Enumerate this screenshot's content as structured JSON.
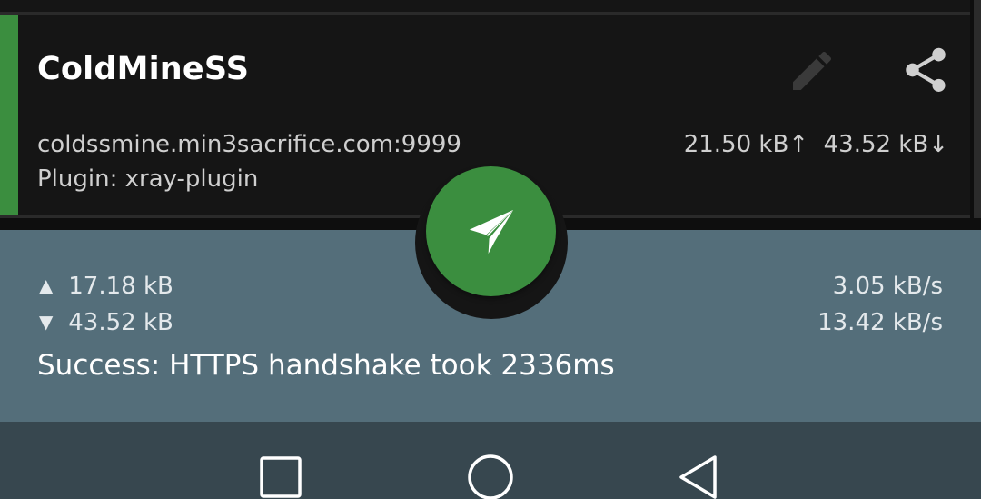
{
  "colors": {
    "accent": "#3b8e3f",
    "card_bg": "#151515",
    "status_bg": "#546e7a",
    "nav_bg": "#37474f"
  },
  "profile": {
    "name": "ColdMineSS",
    "server": "coldssmine.min3sacrifice.com:9999",
    "plugin": "Plugin: xray-plugin",
    "tx_total": "21.50 kB",
    "tx_arrow": "↑",
    "rx_total": "43.52 kB",
    "rx_arrow": "↓",
    "edit_icon": "pencil-icon",
    "share_icon": "share-icon"
  },
  "fab": {
    "icon": "paper-plane-icon"
  },
  "status": {
    "up_symbol": "▲",
    "down_symbol": "▼",
    "tx": "17.18 kB",
    "rx": "43.52 kB",
    "tx_rate": "3.05 kB/s",
    "rx_rate": "13.42 kB/s",
    "message": "Success: HTTPS handshake took 2336ms"
  },
  "nav": {
    "recents_icon": "square-icon",
    "home_icon": "circle-icon",
    "back_icon": "triangle-back-icon"
  }
}
